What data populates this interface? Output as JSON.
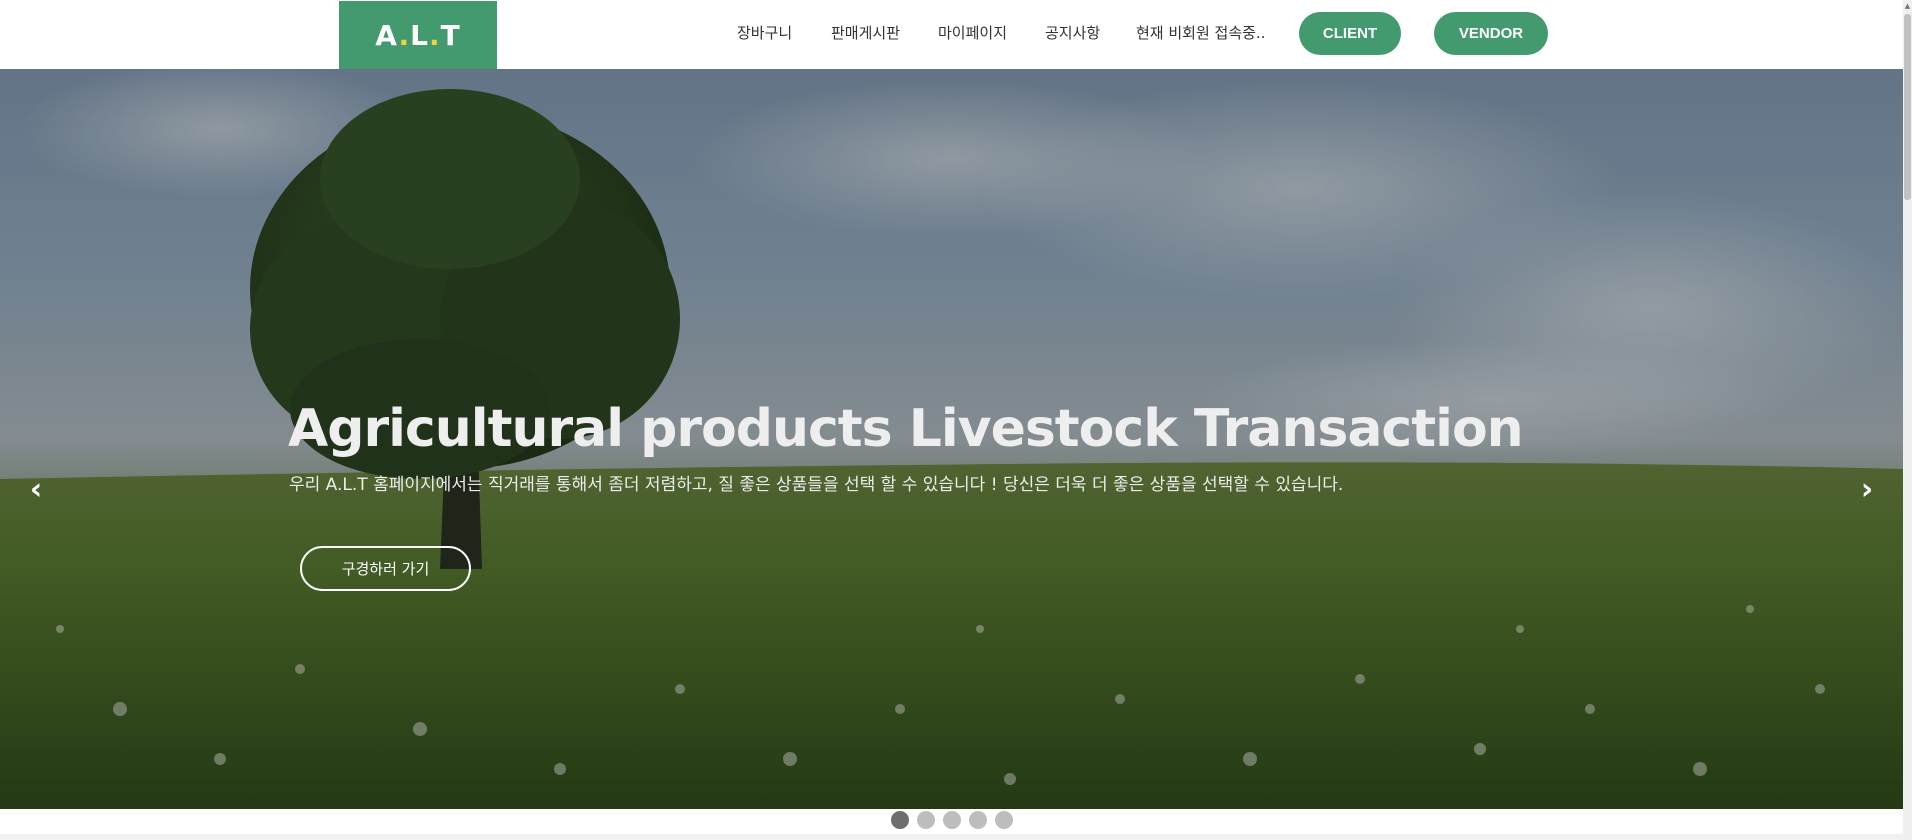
{
  "header": {
    "logo": {
      "letters": [
        "A",
        ".",
        "L",
        ".",
        "T"
      ],
      "accent_color": "#f2d13b",
      "bg_color": "#439a6e"
    },
    "nav": [
      {
        "label": "장바구니"
      },
      {
        "label": "판매게시판"
      },
      {
        "label": "마이페이지"
      },
      {
        "label": "공지사항"
      },
      {
        "label": "현재 비회원 접속중.."
      }
    ],
    "client_button": "CLIENT",
    "vendor_button": "VENDOR"
  },
  "hero": {
    "title": "Agricultural products Livestock Transaction",
    "subtitle": "우리 A.L.T 홈페이지에서는 직거래를 통해서 좀더 저렴하고, 질 좋은 상품들을 선택 할 수 있습니다 ! 당신은 더욱 더 좋은 상품을 선택할 수 있습니다.",
    "cta_button": "구경하러 가기",
    "prev_arrow": "‹",
    "next_arrow": "›"
  },
  "carousel": {
    "slide_count": 5,
    "active_index": 0
  },
  "colors": {
    "brand_green": "#439a6e",
    "dot_active": "#6e6e6e",
    "dot_inactive": "#bdbdbd"
  },
  "icons": {
    "prev": "chevron-left-icon",
    "next": "chevron-right-icon"
  }
}
